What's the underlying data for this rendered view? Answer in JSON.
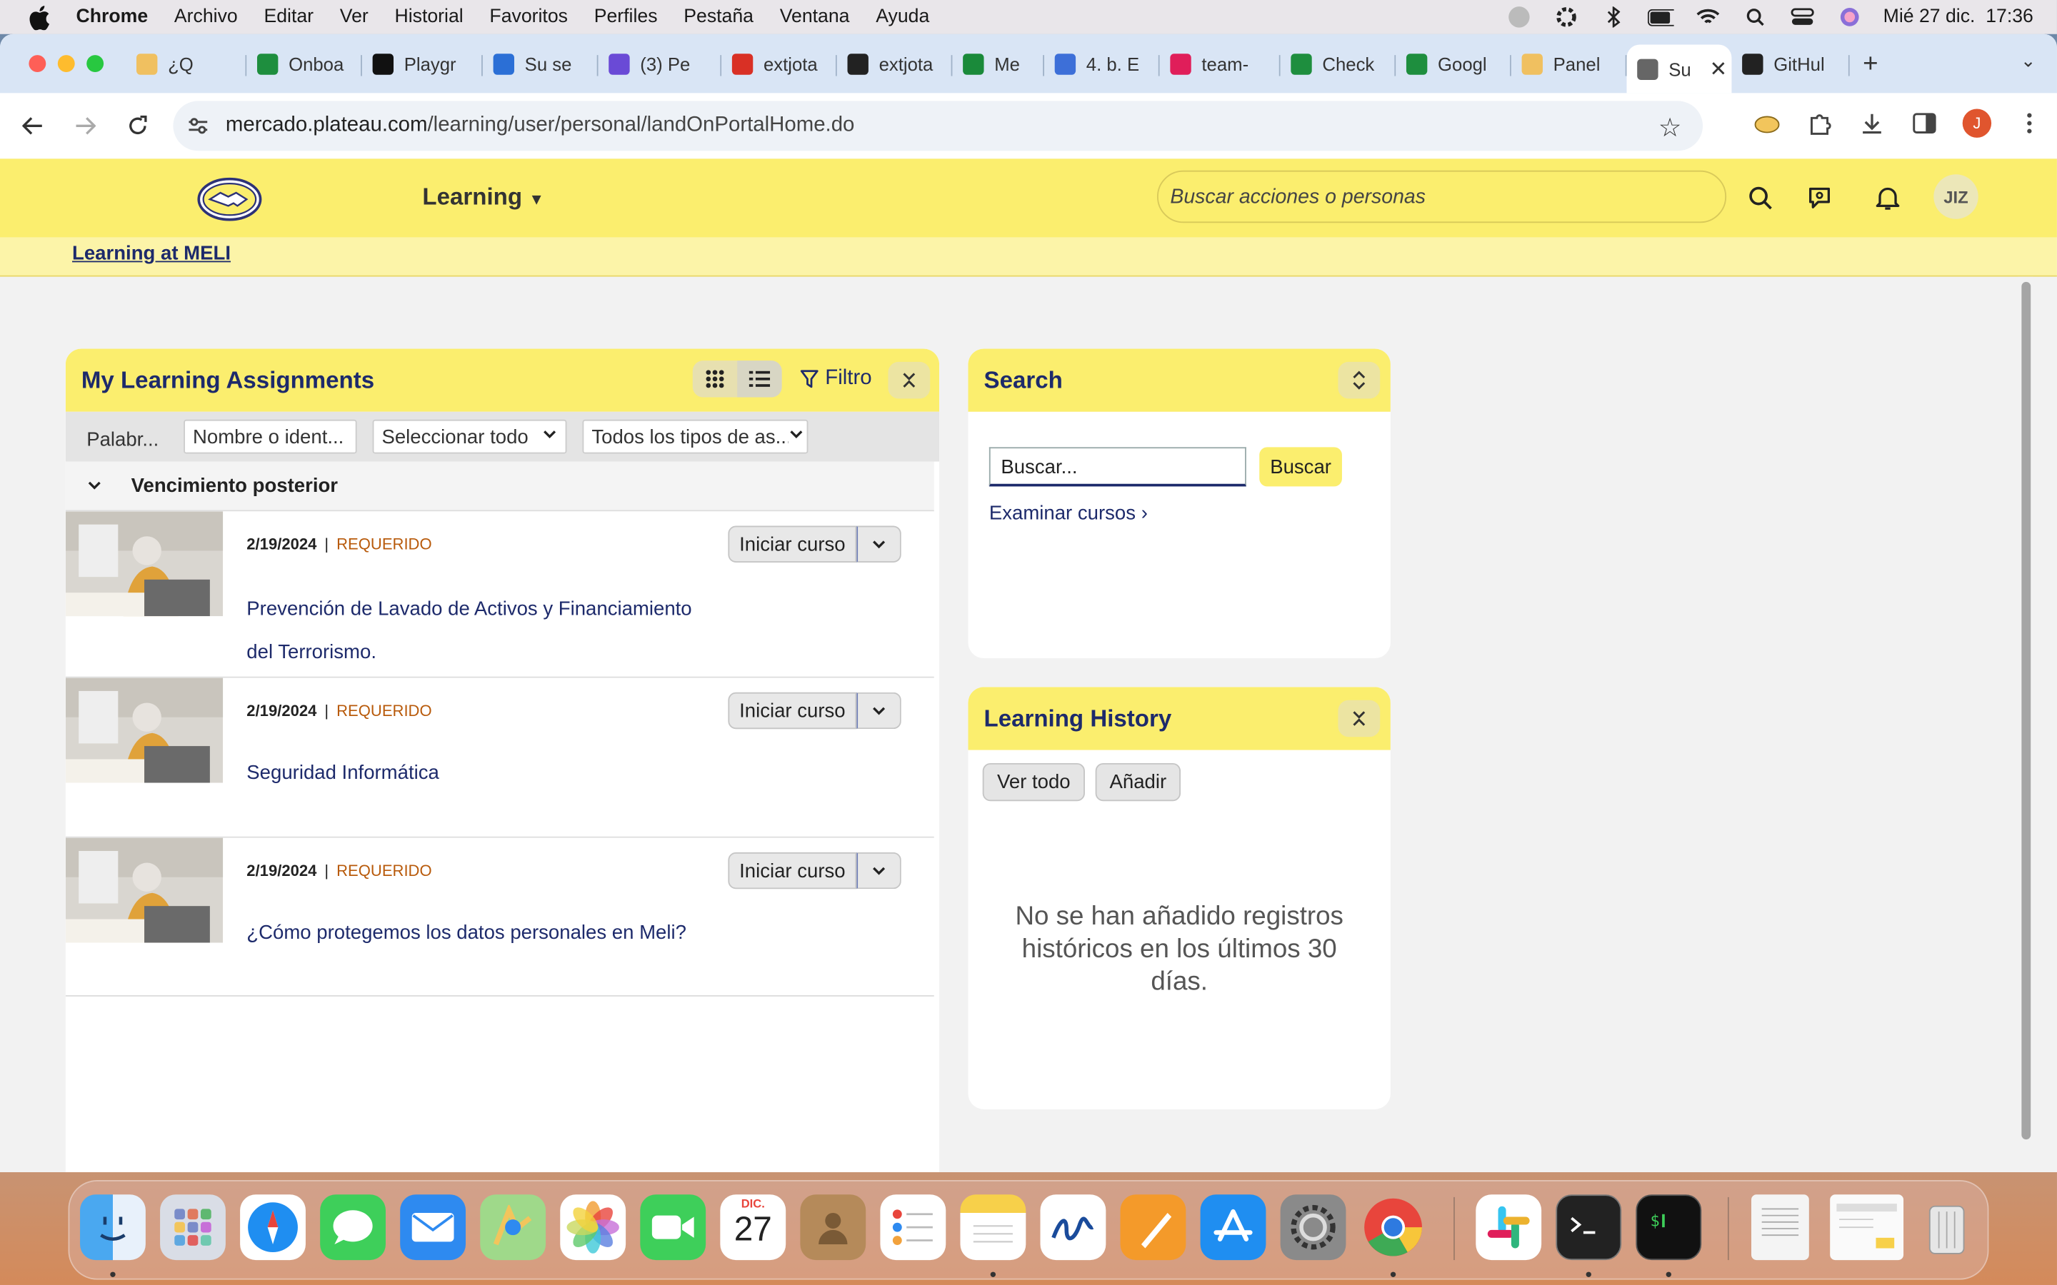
{
  "menubar": {
    "items": [
      "Chrome",
      "Archivo",
      "Editar",
      "Ver",
      "Historial",
      "Favoritos",
      "Perfiles",
      "Pestaña",
      "Ventana",
      "Ayuda"
    ],
    "datetime": "Mié 27 dic.  17:36"
  },
  "tabs": [
    {
      "label": "¿Q",
      "color": "#f0c060"
    },
    {
      "label": "Onboa",
      "color": "#1e8e3e"
    },
    {
      "label": "Playgr",
      "color": "#111111"
    },
    {
      "label": "Su se",
      "color": "#2b6fd6"
    },
    {
      "label": "(3) Pe",
      "color": "#6a4ad6"
    },
    {
      "label": "extjota",
      "color": "#d93025"
    },
    {
      "label": "extjota",
      "color": "#222222"
    },
    {
      "label": "Me",
      "color": "#1a8a3a"
    },
    {
      "label": "4. b. E",
      "color": "#3d6fd8"
    },
    {
      "label": "team-",
      "color": "#e01e5a"
    },
    {
      "label": "Check",
      "color": "#1e8e3e"
    },
    {
      "label": "Googl",
      "color": "#1e8e3e"
    },
    {
      "label": "Panel",
      "color": "#f0c060"
    },
    {
      "label": "Su",
      "color": "#666666",
      "active": true
    },
    {
      "label": "GitHul",
      "color": "#222222"
    }
  ],
  "toolbar": {
    "url_host": "mercado.plateau.com",
    "url_path": "/learning/user/personal/landOnPortalHome.do",
    "profile_initial": "J"
  },
  "header": {
    "menu_label": "Learning",
    "search_placeholder": "Buscar acciones o personas",
    "user_initials": "JIZ",
    "sublink": "Learning at MELI"
  },
  "assignments": {
    "title": "My Learning Assignments",
    "filter_label": "Filtro",
    "keyword_label": "Palabr...",
    "name_field": "Nombre o ident...",
    "select_all": "Seleccionar todo",
    "types": "Todos los tipos de as...",
    "group_label": "Vencimiento posterior",
    "items": [
      {
        "date": "2/19/2024",
        "status": "REQUERIDO",
        "title_line1": "Prevención de Lavado de Activos y Financiamiento",
        "title_line2": "del Terrorismo.",
        "action": "Iniciar curso"
      },
      {
        "date": "2/19/2024",
        "status": "REQUERIDO",
        "title_line1": "Seguridad Informática",
        "title_line2": "",
        "action": "Iniciar curso"
      },
      {
        "date": "2/19/2024",
        "status": "REQUERIDO",
        "title_line1": "¿Cómo protegemos los datos personales en Meli?",
        "title_line2": "",
        "action": "Iniciar curso"
      }
    ]
  },
  "search_panel": {
    "title": "Search",
    "input_value": "Buscar...",
    "button": "Buscar",
    "browse_link": "Examinar cursos"
  },
  "history_panel": {
    "title": "Learning History",
    "view_all": "Ver todo",
    "add": "Añadir",
    "empty_message": "No se han añadido registros históricos en los últimos 30 días."
  },
  "dock": {
    "calendar_month": "DIC.",
    "calendar_day": "27",
    "apps": [
      "finder",
      "launchpad",
      "safari",
      "messages",
      "mail",
      "maps",
      "photos",
      "facetime",
      "calendar",
      "contacts",
      "reminders",
      "notes",
      "freeform",
      "pages",
      "app-store",
      "system-settings",
      "chrome",
      "slack",
      "terminal",
      "iterm",
      "document",
      "notes-window",
      "trash"
    ]
  },
  "colors": {
    "header_yellow": "#fbee6e",
    "navy": "#1d2a6b",
    "required_orange": "#b85a0b"
  }
}
